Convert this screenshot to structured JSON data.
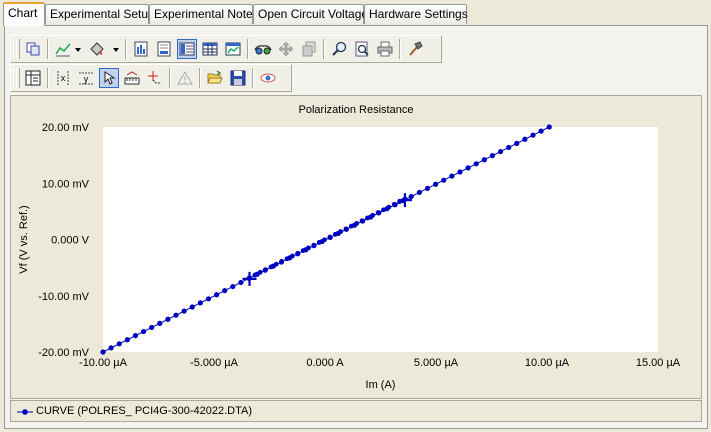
{
  "tabs": [
    {
      "label": "Chart",
      "active": true
    },
    {
      "label": "Experimental Setup"
    },
    {
      "label": "Experimental Notes"
    },
    {
      "label": "Open Circuit Voltage"
    },
    {
      "label": "Hardware Settings"
    }
  ],
  "toolbar1": {
    "icons": [
      "copy-icon",
      "chart-type-icon",
      "fill-color-icon",
      "bar-chart-icon",
      "list-view-icon",
      "detail-view-icon",
      "grid-table-icon",
      "chart-image-icon",
      "3d-glasses-icon",
      "move-icon",
      "copy-pages-icon",
      "zoom-icon",
      "zoom-page-icon",
      "print-icon",
      "hammer-icon"
    ]
  },
  "toolbar2": {
    "icons": [
      "data-table-icon",
      "cursor-x-icon",
      "cursor-y-icon",
      "select-tool-icon",
      "baseline-icon",
      "point-cursor-icon",
      "warning-icon",
      "open-folder-icon",
      "save-icon",
      "view-eye-icon"
    ]
  },
  "colors": {
    "series": "#0000c0",
    "plot_bg": "#ffffff",
    "frame_bg": "#ece9d8"
  },
  "chart_data": {
    "type": "scatter",
    "title": "Polarization Resistance",
    "xlabel": "Im (A)",
    "ylabel": "Vf (V vs. Ref.)",
    "xlim": [
      -10.0,
      15.0
    ],
    "ylim": [
      -20.0,
      20.0
    ],
    "x_unit": "µA",
    "y_unit": "mV",
    "x_tick_labels": [
      "-10.00 µA",
      "-5.000 µA",
      "0.000 A",
      "5.000 µA",
      "10.00 µA",
      "15.00 µA"
    ],
    "y_tick_labels": [
      "20.00 mV",
      "10.00 mV",
      "0.000 V",
      "-10.00 mV",
      "-20.00 mV"
    ],
    "x_ticks": [
      -10,
      -5,
      0,
      5,
      10,
      15
    ],
    "y_ticks": [
      20,
      10,
      0,
      -10,
      -20
    ],
    "series": [
      {
        "name": "CURVE (POLRES_ PCI4G-300-42022.DTA)",
        "x_start": -10.0,
        "x_end": 10.1,
        "y_start": -20.0,
        "y_end": 20.0,
        "points": 56
      }
    ],
    "fit_markers": [
      {
        "x": -3.4,
        "y": -7.0
      },
      {
        "x": 3.6,
        "y": 7.0
      }
    ],
    "grid": false,
    "legend_position": "bottom"
  }
}
